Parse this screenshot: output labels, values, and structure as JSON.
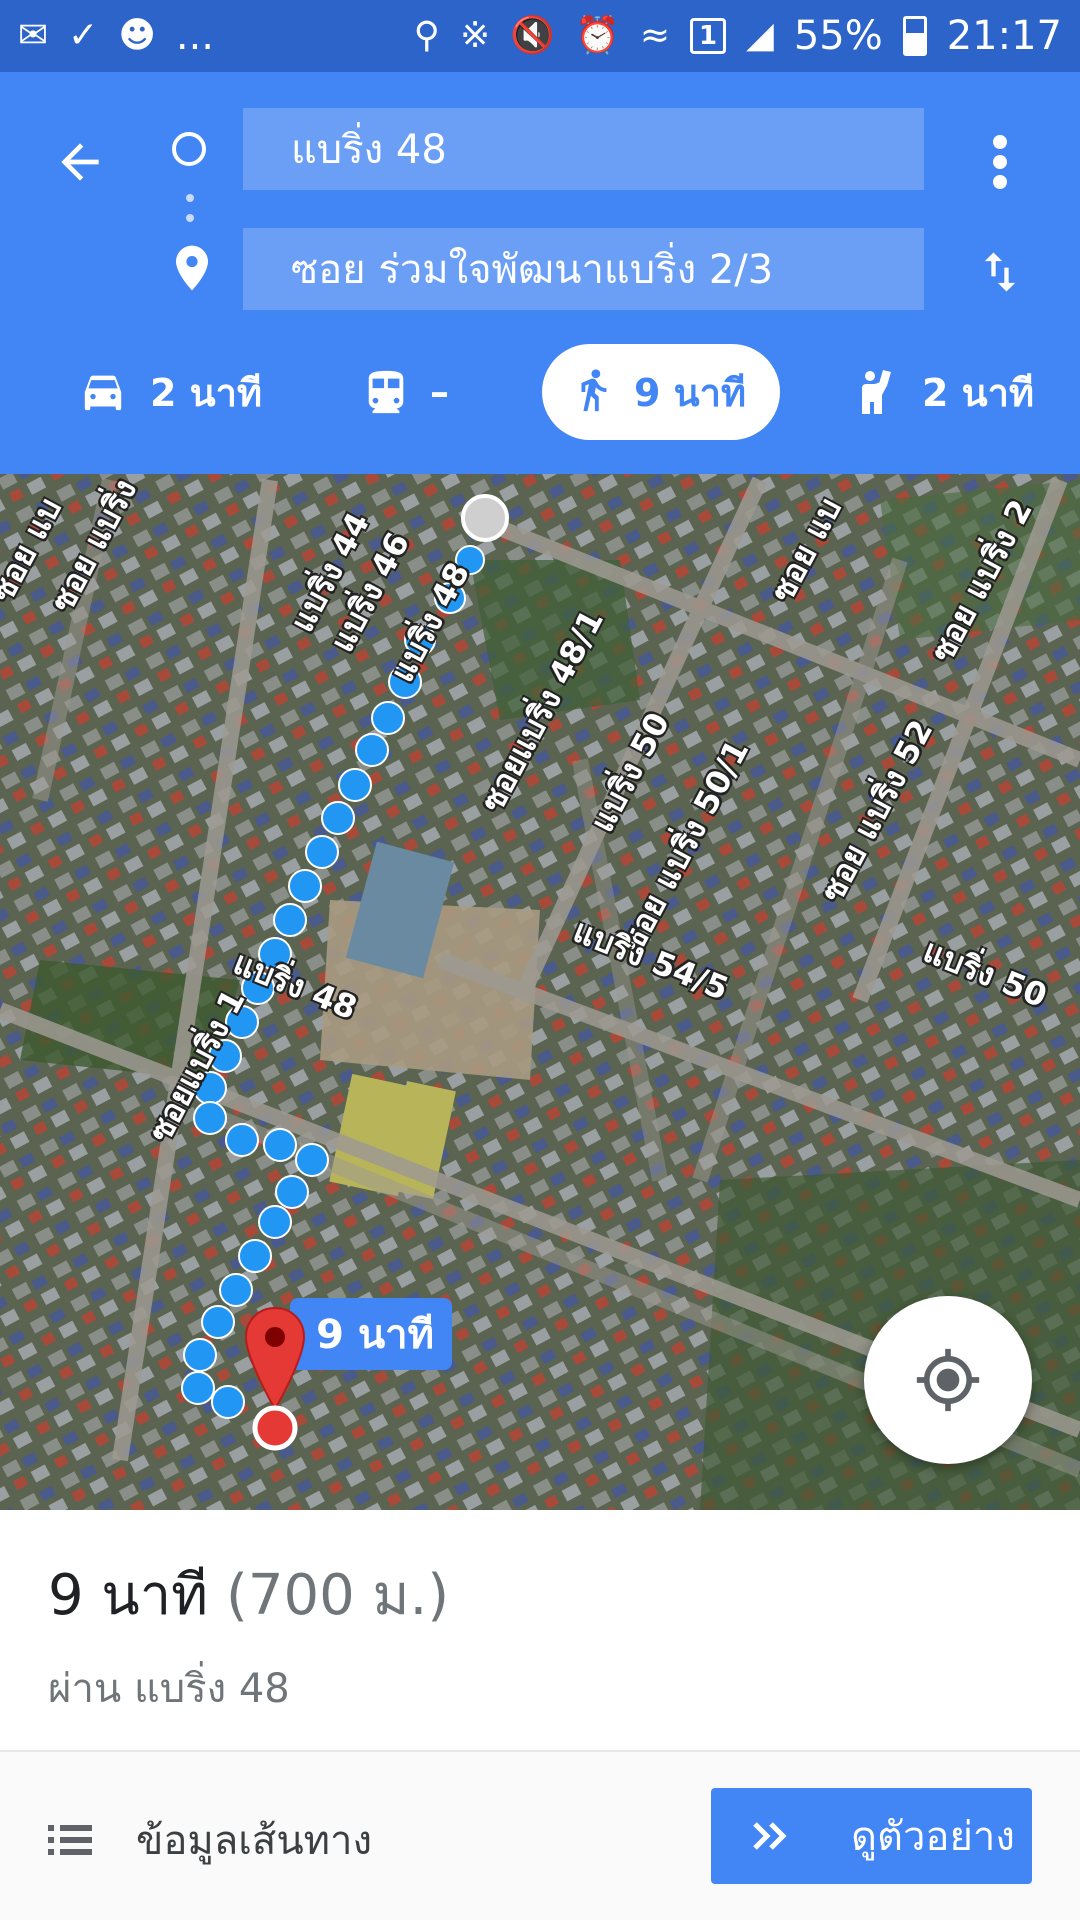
{
  "status_bar": {
    "left_icons": [
      "message-icon",
      "check-icon",
      "contacts-icon"
    ],
    "more": "...",
    "right_icons": [
      "location-icon",
      "bluetooth-icon",
      "mute-icon",
      "alarm-icon",
      "wifi-icon"
    ],
    "sim": "1",
    "battery": "55%",
    "time": "21:17"
  },
  "header": {
    "origin": "แบริ่ง 48",
    "destination": "ซอย ร่วมใจพัฒนาแบริ่ง 2/3",
    "modes": [
      {
        "name": "drive",
        "label": "2 นาที"
      },
      {
        "name": "transit",
        "label": "–"
      },
      {
        "name": "walk",
        "label": "9 นาที",
        "selected": true
      },
      {
        "name": "ride",
        "label": "2 นาที"
      }
    ]
  },
  "map": {
    "road_labels": [
      "ซอย แบ",
      "ซอย แบริ่ง",
      "แบริ่ง 44",
      "แบริ่ง 46",
      "แบริ่ง 48",
      "ซอยแบริ่ง 48/1",
      "ซอย แบ",
      "ซอย แบริ่ง 2",
      "แบริ่ง 50",
      "ซอย แบริ่ง 50/1",
      "ซอย แบริ่ง 52",
      "แบริ่ง 48",
      "ซอยแบริ่ง 1",
      "แบริ่ง 54/5",
      "แบริ่ง 50"
    ],
    "eta_bubble": "9 นาที"
  },
  "summary": {
    "duration": "9 นาที",
    "distance": "(700 ม.)",
    "via": "ผ่าน แบริ่ง 48"
  },
  "footer": {
    "steps_label": "ข้อมูลเส้นทาง",
    "preview_label": "ดูตัวอย่าง"
  },
  "colors": {
    "header": "#4285f4",
    "status_bar": "#2c64c9",
    "route": "#2196f3",
    "pin": "#e53935"
  }
}
